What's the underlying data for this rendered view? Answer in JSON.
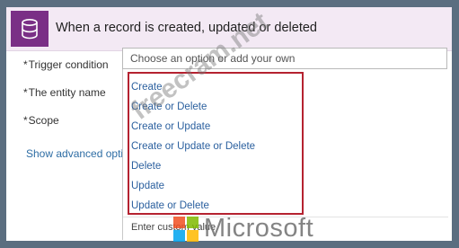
{
  "header": {
    "title": "When a record is created, updated or deleted",
    "icon": "database-icon",
    "icon_bg": "#7a2f86"
  },
  "fields": {
    "trigger_label": "Trigger condition",
    "entity_label": "The entity name",
    "scope_label": "Scope",
    "required_marker": "*",
    "trigger_placeholder": "Choose an option or add your own"
  },
  "advanced_link": "Show advanced options",
  "dropdown": {
    "options": [
      "Create",
      "Create or Delete",
      "Create or Update",
      "Create or Update or Delete",
      "Delete",
      "Update",
      "Update or Delete"
    ],
    "footer": "Enter custom value"
  },
  "watermark": {
    "text": "freecram.net"
  },
  "brand": {
    "name": "Microsoft",
    "squares": [
      "#f25022",
      "#7fba00",
      "#00a4ef",
      "#ffb900"
    ]
  },
  "colors": {
    "highlight": "#b52230",
    "link": "#2a5f9e"
  }
}
